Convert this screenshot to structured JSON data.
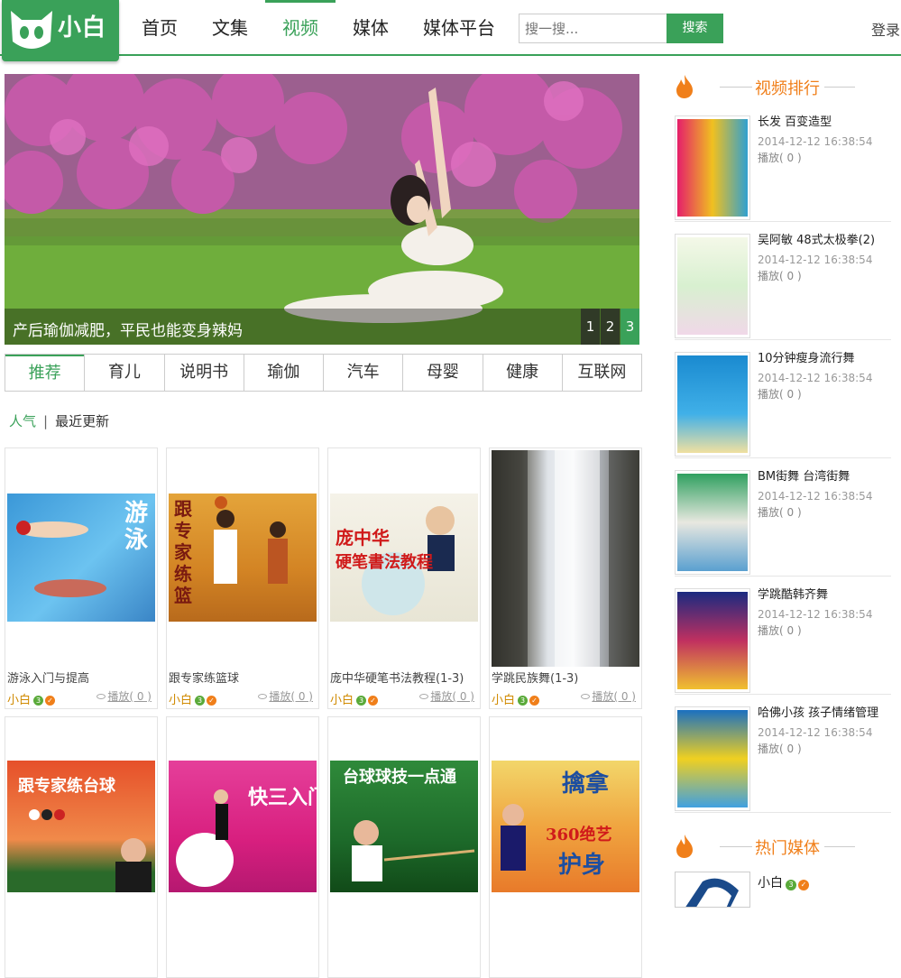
{
  "header": {
    "logo_text": "小白",
    "nav": [
      "首页",
      "文集",
      "视频",
      "媒体",
      "媒体平台"
    ],
    "active_nav": "视频",
    "search_placeholder": "搜一搜...",
    "search_button": "搜索",
    "login": "登录"
  },
  "banner": {
    "caption": "产后瑜伽减肥，平民也能变身辣妈",
    "pages": [
      "1",
      "2",
      "3"
    ],
    "active_page": "3"
  },
  "tabs": [
    "推荐",
    "育儿",
    "说明书",
    "瑜伽",
    "汽车",
    "母婴",
    "健康",
    "互联网"
  ],
  "sort": {
    "popular": "人气",
    "separator": "|",
    "latest": "最近更新"
  },
  "cards": [
    {
      "title": "游泳入门与提高",
      "author": "小白",
      "level": "3",
      "play": "播放( 0 )",
      "thumb_text": "游泳入门与提高"
    },
    {
      "title": "跟专家练篮球",
      "author": "小白",
      "level": "3",
      "play": "播放( 0 )",
      "thumb_text": "跟专家练篮球"
    },
    {
      "title": "庞中华硬笔书法教程(1-3)",
      "author": "小白",
      "level": "3",
      "play": "播放( 0 )",
      "thumb_text": "庞中华 硬笔书法教程"
    },
    {
      "title": "学跳民族舞(1-3)",
      "author": "小白",
      "level": "3",
      "play": "播放( 0 )",
      "thumb_text": ""
    },
    {
      "title": "",
      "author": "",
      "level": "",
      "play": "",
      "thumb_text": "跟专家练台球"
    },
    {
      "title": "",
      "author": "",
      "level": "",
      "play": "",
      "thumb_text": "快三入门"
    },
    {
      "title": "",
      "author": "",
      "level": "",
      "play": "",
      "thumb_text": "台球球技一点通"
    },
    {
      "title": "",
      "author": "",
      "level": "",
      "play": "",
      "thumb_text": "擒拿护身 360绝艺"
    }
  ],
  "sidebar": {
    "rank_title": "视频排行",
    "ranks": [
      {
        "title": "长发 百变造型",
        "date": "2014-12-12 16:38:54",
        "play": "播放( 0 )",
        "thumb_text": "长发百变造型"
      },
      {
        "title": "吴阿敏 48式太极拳(2)",
        "date": "2014-12-12 16:38:54",
        "play": "播放( 0 )",
        "thumb_text": "太极拳"
      },
      {
        "title": "10分钟瘦身流行舞",
        "date": "2014-12-12 16:38:54",
        "play": "播放( 0 )",
        "thumb_text": "10分钟瘦身流行舞"
      },
      {
        "title": "BM街舞 台湾街舞",
        "date": "2014-12-12 16:38:54",
        "play": "播放( 0 )",
        "thumb_text": "台湾街舞"
      },
      {
        "title": "学跳酷韩齐舞",
        "date": "2014-12-12 16:38:54",
        "play": "播放( 0 )",
        "thumb_text": "学跳酷韩齐舞"
      },
      {
        "title": "哈佛小孩 孩子情绪管理",
        "date": "2014-12-12 16:38:54",
        "play": "播放( 0 )",
        "thumb_text": "哈佛小孩"
      }
    ],
    "media_title": "热门媒体",
    "media_name": "小白",
    "media_level": "3"
  },
  "colors": {
    "brand": "#3aa159",
    "accent": "#f07f1a"
  }
}
